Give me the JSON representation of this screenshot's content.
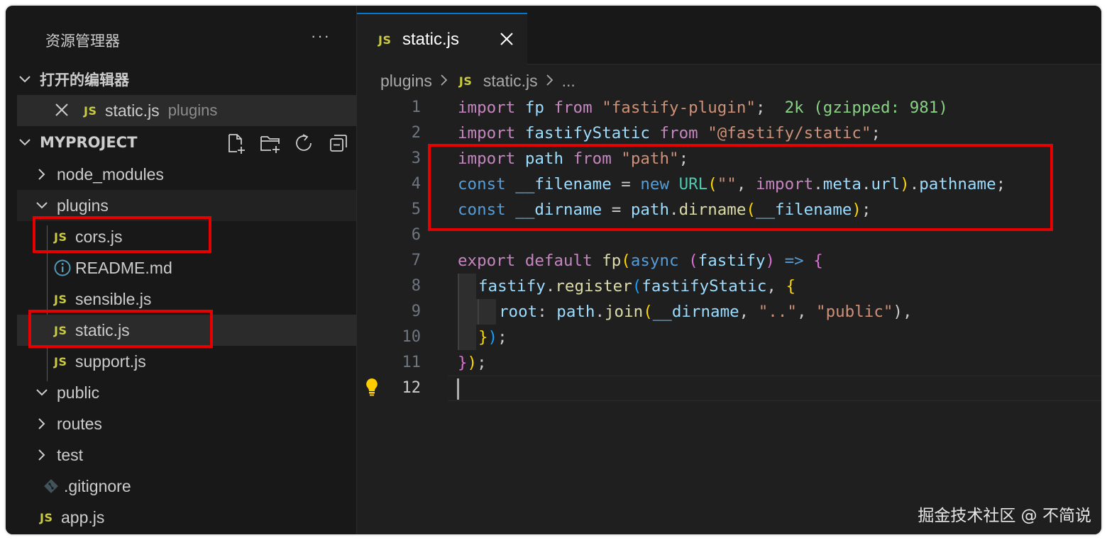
{
  "explorer": {
    "title": "资源管理器",
    "more": "···",
    "open_editors": {
      "label": "打开的编辑器",
      "items": [
        {
          "icon": "JS",
          "name": "static.js",
          "path": "plugins"
        }
      ]
    },
    "project": {
      "label": "MYPROJECT",
      "actions": [
        "new-file-icon",
        "new-folder-icon",
        "refresh-icon",
        "collapse-all-icon"
      ],
      "tree": [
        {
          "name": "node_modules",
          "type": "folder",
          "expanded": false
        },
        {
          "name": "plugins",
          "type": "folder",
          "expanded": true
        },
        {
          "name": "cors.js",
          "type": "js",
          "icon": "JS"
        },
        {
          "name": "README.md",
          "type": "info"
        },
        {
          "name": "sensible.js",
          "type": "js",
          "icon": "JS"
        },
        {
          "name": "static.js",
          "type": "js",
          "icon": "JS",
          "selected": true
        },
        {
          "name": "support.js",
          "type": "js",
          "icon": "JS"
        },
        {
          "name": "public",
          "type": "folder",
          "expanded": true
        },
        {
          "name": "routes",
          "type": "folder",
          "expanded": false
        },
        {
          "name": "test",
          "type": "folder",
          "expanded": false
        },
        {
          "name": ".gitignore",
          "type": "git"
        },
        {
          "name": "app.js",
          "type": "js",
          "icon": "JS"
        }
      ]
    }
  },
  "editor": {
    "tab": {
      "icon": "JS",
      "label": "static.js"
    },
    "breadcrumb": {
      "folder": "plugins",
      "icon": "JS",
      "file": "static.js",
      "tail": "..."
    },
    "line_numbers": [
      "1",
      "2",
      "3",
      "4",
      "5",
      "6",
      "7",
      "8",
      "9",
      "10",
      "11",
      "12"
    ],
    "current_line": "12",
    "code": {
      "l1": [
        "import",
        " ",
        "fp",
        " ",
        "from",
        " ",
        "\"fastify-plugin\"",
        ";",
        "  2k (gzipped: 981)"
      ],
      "l2": [
        "import",
        " ",
        "fastifyStatic",
        " ",
        "from",
        " ",
        "\"@fastify/static\"",
        ";"
      ],
      "l3": [
        "import",
        " ",
        "path",
        " ",
        "from",
        " ",
        "\"path\"",
        ";"
      ],
      "l4": [
        "const",
        " ",
        "__filename",
        " = ",
        "new",
        " ",
        "URL",
        "(",
        "\"\"",
        ", ",
        "import",
        ".",
        "meta",
        ".",
        "url",
        ")",
        ".",
        "pathname",
        ";"
      ],
      "l5": [
        "const",
        " ",
        "__dirname",
        " = ",
        "path",
        ".",
        "dirname",
        "(",
        "__filename",
        ")",
        ";"
      ],
      "l7": [
        "export",
        " ",
        "default",
        " ",
        "fp",
        "(",
        "async",
        " ",
        "(",
        "fastify",
        ")",
        " ",
        "=>",
        " ",
        "{"
      ],
      "l8": [
        "fastify",
        ".",
        "register",
        "(",
        "fastifyStatic",
        ", ",
        "{"
      ],
      "l9": [
        "root",
        ": ",
        "path",
        ".",
        "join",
        "(",
        "__dirname",
        ", ",
        "\"..\"",
        ", ",
        "\"public\"",
        "),"
      ],
      "l10": [
        "}",
        ")",
        ";"
      ],
      "l11": [
        "}",
        ")",
        ";"
      ]
    }
  },
  "watermark": "掘金技术社区 @ 不简说",
  "colors": {
    "highlight_box": "#e60000",
    "keyword": "#c586c0",
    "storage": "#569cd6",
    "variable": "#9cdcfe",
    "string": "#ce9178",
    "function": "#dcdcaa",
    "class": "#4ec9b0",
    "js_icon": "#cbcb41",
    "tab_accent": "#0078d4"
  }
}
